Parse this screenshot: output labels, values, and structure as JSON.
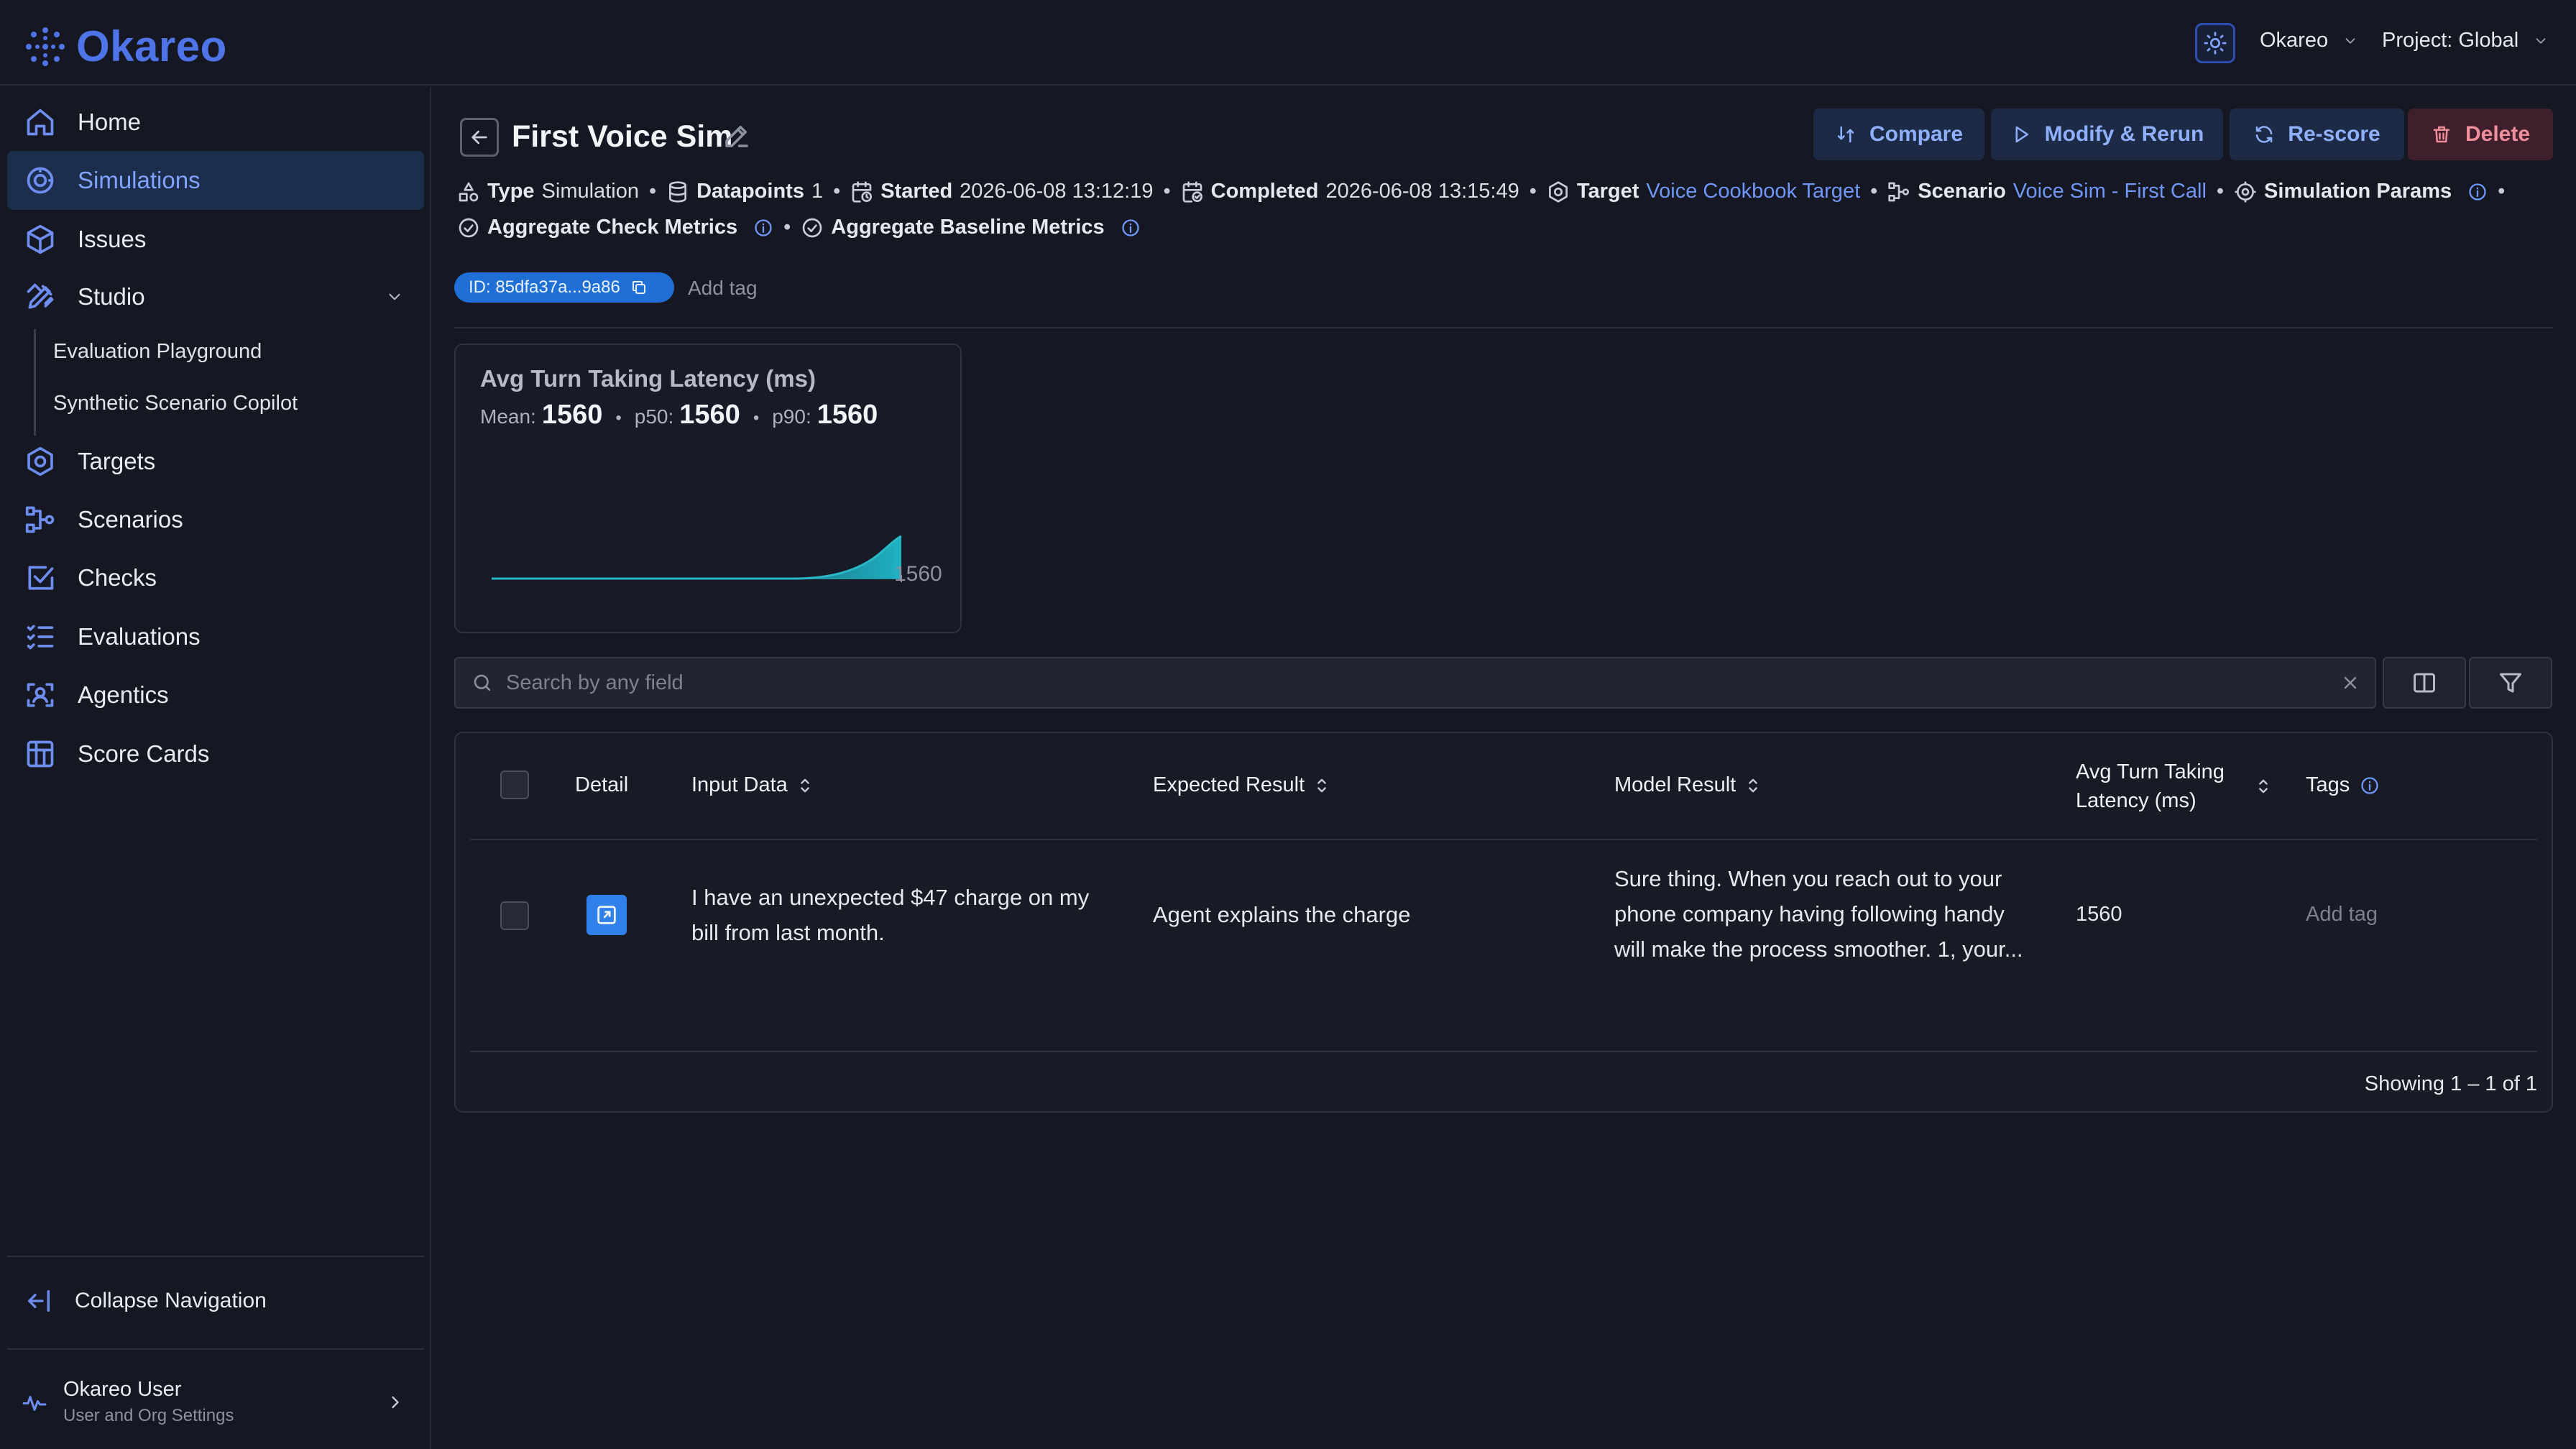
{
  "app": {
    "name": "Okareo"
  },
  "topbar": {
    "org": "Okareo",
    "project": "Project: Global"
  },
  "sidebar": {
    "items": [
      {
        "label": "Home",
        "icon": "home-icon"
      },
      {
        "label": "Simulations",
        "icon": "simulations-icon",
        "active": true
      },
      {
        "label": "Issues",
        "icon": "cube-icon"
      },
      {
        "label": "Studio",
        "icon": "pencil-ruler-icon"
      },
      {
        "label": "Targets",
        "icon": "hexagon-icon"
      },
      {
        "label": "Scenarios",
        "icon": "flow-icon"
      },
      {
        "label": "Checks",
        "icon": "check-square-icon"
      },
      {
        "label": "Evaluations",
        "icon": "list-check-icon"
      },
      {
        "label": "Agentics",
        "icon": "scan-user-icon"
      },
      {
        "label": "Score Cards",
        "icon": "table-icon"
      }
    ],
    "studio_sub": [
      "Evaluation Playground",
      "Synthetic Scenario Copilot"
    ],
    "collapse_label": "Collapse Navigation",
    "user": {
      "name": "Okareo User",
      "subtitle": "User and Org Settings"
    }
  },
  "page": {
    "title": "First Voice Sim",
    "actions": {
      "compare": "Compare",
      "modify": "Modify & Rerun",
      "rescore": "Re-score",
      "delete": "Delete"
    },
    "meta": {
      "type_label": "Type",
      "type_value": "Simulation",
      "datapoints_label": "Datapoints",
      "datapoints_value": "1",
      "started_label": "Started",
      "started_value": "2026-06-08 13:12:19",
      "completed_label": "Completed",
      "completed_value": "2026-06-08 13:15:49",
      "target_label": "Target",
      "target_value": "Voice Cookbook Target",
      "scenario_label": "Scenario",
      "scenario_value": "Voice Sim - First Call",
      "params_label": "Simulation Params",
      "agg_check_label": "Aggregate Check Metrics",
      "agg_baseline_label": "Aggregate Baseline Metrics"
    },
    "id_tag": "ID: 85dfa37a...9a86",
    "add_tag": "Add tag"
  },
  "metric_card": {
    "title": "Avg Turn Taking Latency (ms)",
    "mean_label": "Mean:",
    "mean_value": "1560",
    "p50_label": "p50:",
    "p50_value": "1560",
    "p90_label": "p90:",
    "p90_value": "1560",
    "axis_label": "1560"
  },
  "search": {
    "placeholder": "Search by any field"
  },
  "table": {
    "headers": {
      "detail": "Detail",
      "input": "Input Data",
      "expected": "Expected Result",
      "model": "Model Result",
      "latency_1": "Avg Turn Taking",
      "latency_2": "Latency (ms)",
      "tags": "Tags"
    },
    "rows": [
      {
        "input_1": "I have an unexpected $47 charge on my",
        "input_2": "bill from last month.",
        "expected": "Agent explains the charge",
        "model_1": "Sure thing. When you reach out to your",
        "model_2": "phone company having following handy",
        "model_3": "will make the process smoother. 1, your...",
        "latency": "1560",
        "tags": "Add tag"
      }
    ],
    "footer": "Showing 1 – 1 of 1"
  },
  "colors": {
    "accent": "#4f74e8",
    "active_bg": "#1d2d4c",
    "danger": "#ef8e9a",
    "link": "#6e97f7"
  }
}
